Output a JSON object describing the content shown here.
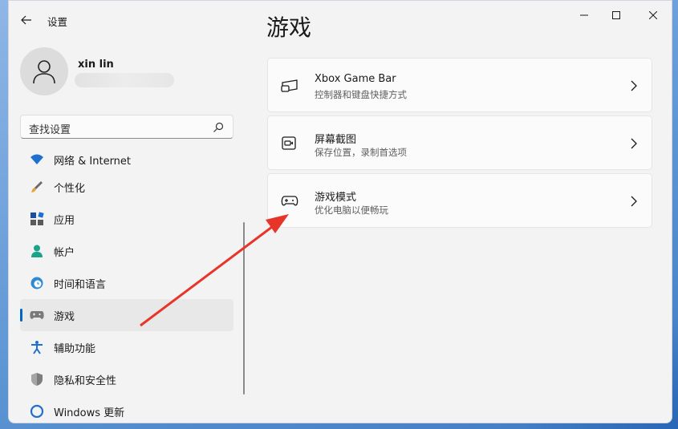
{
  "window": {
    "title": "设置"
  },
  "profile": {
    "name": "xin lin"
  },
  "search": {
    "placeholder": "查找设置"
  },
  "nav": {
    "items": [
      {
        "label": "网络 & Internet",
        "icon": "wifi-icon"
      },
      {
        "label": "个性化",
        "icon": "brush-icon"
      },
      {
        "label": "应用",
        "icon": "apps-icon"
      },
      {
        "label": "帐户",
        "icon": "person-icon"
      },
      {
        "label": "时间和语言",
        "icon": "globe-clock-icon"
      },
      {
        "label": "游戏",
        "icon": "gamepad-icon",
        "selected": true
      },
      {
        "label": "辅助功能",
        "icon": "accessibility-icon"
      },
      {
        "label": "隐私和安全性",
        "icon": "shield-icon"
      },
      {
        "label": "Windows 更新",
        "icon": "update-icon"
      }
    ]
  },
  "page": {
    "title": "游戏",
    "cards": [
      {
        "title": "Xbox Game Bar",
        "subtitle": "控制器和键盘快捷方式",
        "icon": "game-bar-icon"
      },
      {
        "title": "屏幕截图",
        "subtitle": "保存位置，录制首选项",
        "icon": "capture-icon"
      },
      {
        "title": "游戏模式",
        "subtitle": "优化电脑以便畅玩",
        "icon": "gamepad-icon"
      }
    ]
  },
  "colors": {
    "accent": "#0067c0",
    "annotation": "#e8352a"
  }
}
